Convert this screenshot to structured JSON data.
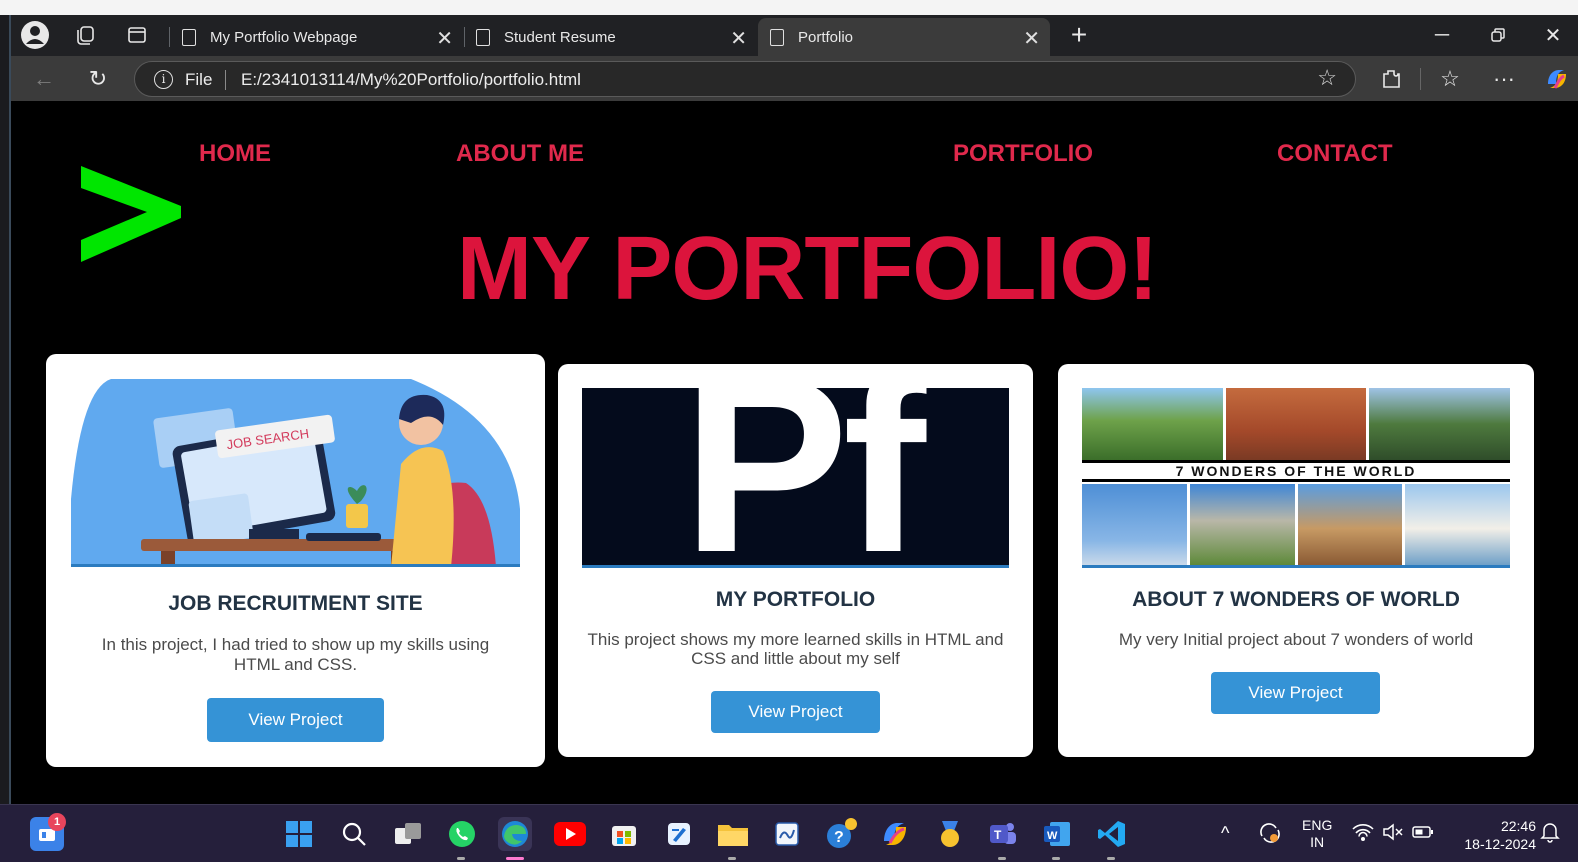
{
  "browser": {
    "tabs": [
      {
        "title": "My Portfolio Webpage",
        "active": false
      },
      {
        "title": "Student Resume",
        "active": false
      },
      {
        "title": "Portfolio",
        "active": true
      }
    ],
    "address": {
      "scheme_label": "File",
      "url": "E:/2341013114/My%20Portfolio/portfolio.html"
    }
  },
  "page": {
    "nav": [
      "HOME",
      "ABOUT ME",
      "PORTFOLIO",
      "CONTACT"
    ],
    "logo_symbol": ">",
    "hero_title": "MY PORTFOLIO!",
    "projects": [
      {
        "title": "JOB RECRUITMENT SITE",
        "description": "In this project, I had tried to show up my skills using HTML and CSS.",
        "button": "View Project",
        "image_caption": "JOB SEARCH"
      },
      {
        "title": "MY PORTFOLIO",
        "description": "This project shows my more learned skills in HTML and CSS and little about my self",
        "button": "View Project",
        "image_caption": "Pf"
      },
      {
        "title": "ABOUT 7 WONDERS OF WORLD",
        "description": "My very Initial project about 7 wonders of world",
        "button": "View Project",
        "image_caption": "7 WONDERS OF THE WORLD"
      }
    ]
  },
  "taskbar": {
    "notification_count": "1",
    "language": "ENG",
    "region": "IN",
    "time": "22:46",
    "date": "18-12-2024"
  },
  "colors": {
    "accent": "#dc143c",
    "logo": "#00e600",
    "button": "#3593d6"
  }
}
